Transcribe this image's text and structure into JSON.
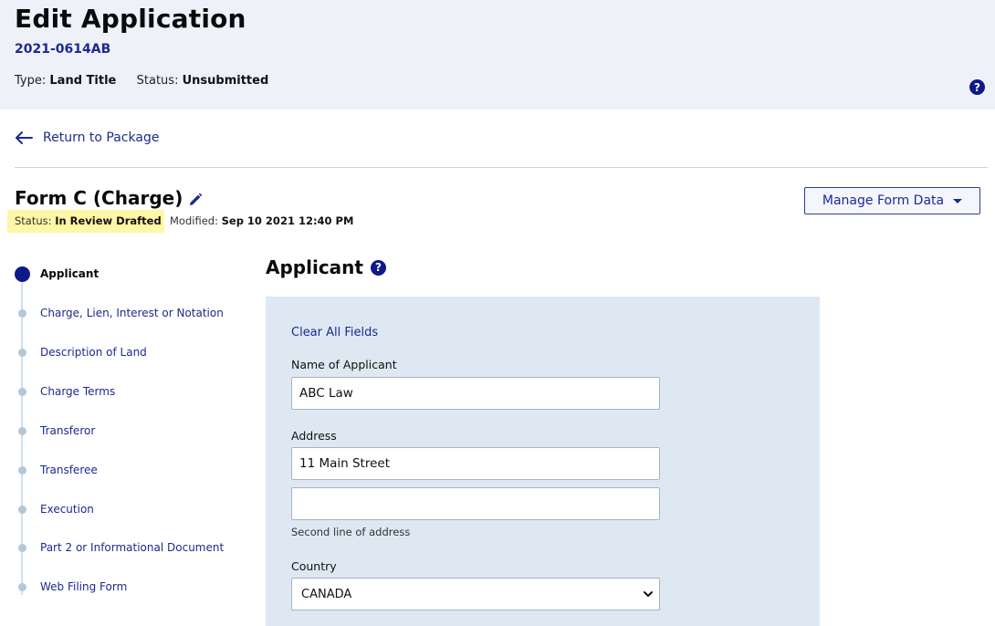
{
  "header": {
    "title": "Edit Application",
    "application_id": "2021-0614AB",
    "type_label": "Type:",
    "type_value": "Land Title",
    "status_label": "Status:",
    "status_value": "Unsubmitted",
    "help_icon": "?"
  },
  "nav": {
    "back_label": "Return to Package"
  },
  "form": {
    "title": "Form C (Charge)",
    "status_label": "Status:",
    "status_value": "In Review Drafted",
    "modified_label": "Modified:",
    "modified_value": "Sep 10 2021 12:40 PM",
    "manage_button": "Manage Form Data"
  },
  "stepper": {
    "steps": [
      {
        "label": "Applicant",
        "active": true
      },
      {
        "label": "Charge, Lien, Interest or Notation",
        "active": false
      },
      {
        "label": "Description of Land",
        "active": false
      },
      {
        "label": "Charge Terms",
        "active": false
      },
      {
        "label": "Transferor",
        "active": false
      },
      {
        "label": "Transferee",
        "active": false
      },
      {
        "label": "Execution",
        "active": false
      },
      {
        "label": "Part 2 or Informational Document",
        "active": false
      },
      {
        "label": "Web Filing Form",
        "active": false
      }
    ]
  },
  "section": {
    "title": "Applicant",
    "help_icon": "?",
    "clear_all": "Clear All Fields",
    "name_label": "Name of Applicant",
    "name_value": "ABC Law",
    "address_label": "Address",
    "address_line1": "11 Main Street",
    "address_line2": "",
    "address_line2_hint": "Second line of address",
    "country_label": "Country",
    "country_value": "CANADA"
  },
  "colors": {
    "brand": "#0d1a8a",
    "link": "#1c2a8f",
    "header_bg": "#eef1f8",
    "panel_bg": "#dde8f2",
    "status_highlight": "#fdf7a6"
  }
}
